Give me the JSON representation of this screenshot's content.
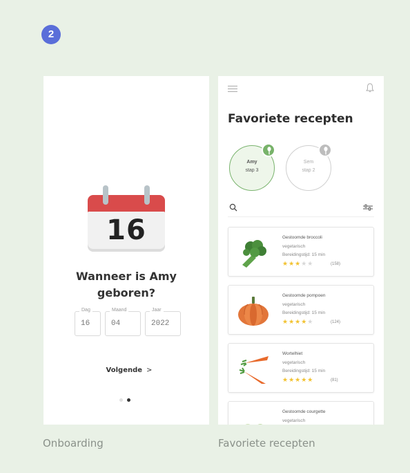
{
  "step": {
    "number": "2"
  },
  "colors": {
    "panel_bg": "#e9f1e6",
    "badge": "#5a6ed9",
    "accent_green": "#78b36a",
    "star": "#f2c230",
    "calendar_red": "#d94b4b"
  },
  "onboarding": {
    "caption": "Onboarding",
    "calendar_day": "16",
    "question_line1": "Wanneer is Amy",
    "question_line2": "geboren?",
    "fields": {
      "day": {
        "label": "Dag",
        "value": "16"
      },
      "month": {
        "label": "Maand",
        "value": "04"
      },
      "year": {
        "label": "Jaar",
        "value": "2022"
      }
    },
    "next_label": "Volgende",
    "next_chevron": ">",
    "pagination": {
      "total": 2,
      "active": 2
    }
  },
  "favorites": {
    "caption": "Favoriete recepten",
    "title": "Favoriete recepten",
    "icons": {
      "menu": "menu-icon",
      "notifications": "bell-icon",
      "search": "search-icon",
      "filter": "filter-icon"
    },
    "profiles": [
      {
        "name": "Amy",
        "step": "stap 3",
        "active": true
      },
      {
        "name": "Sem",
        "step": "stap 2",
        "active": false
      }
    ],
    "recipes": [
      {
        "name": "Gestoomde broccoli",
        "category": "vegetarisch",
        "time": "Bereidingstijd: 15 min",
        "rating": 3,
        "reviews": "(158)",
        "image": "broccoli"
      },
      {
        "name": "Gestoomde pompoen",
        "category": "vegetarisch",
        "time": "Bereidingstijd: 15 min",
        "rating": 4,
        "reviews": "(124)",
        "image": "pumpkin"
      },
      {
        "name": "Wortelhiet",
        "category": "vegetarisch",
        "time": "Bereidingstijd: 15 min",
        "rating": 5,
        "reviews": "(81)",
        "image": "carrots"
      },
      {
        "name": "Gestoomde courgette",
        "category": "vegetarisch",
        "time": "",
        "rating": 0,
        "reviews": "",
        "image": "zucchini"
      }
    ]
  }
}
